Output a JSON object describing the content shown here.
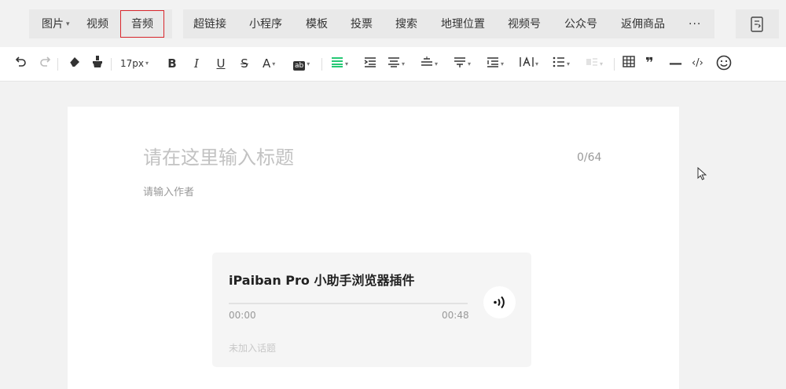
{
  "insert_bar": {
    "items": [
      {
        "label": "图片",
        "caret": "▾"
      },
      {
        "label": "视频"
      },
      {
        "label": "音频"
      },
      {
        "label": "超链接"
      },
      {
        "label": "小程序"
      },
      {
        "label": "模板"
      },
      {
        "label": "投票"
      },
      {
        "label": "搜索"
      },
      {
        "label": "地理位置"
      },
      {
        "label": "视频号"
      },
      {
        "label": "公众号"
      },
      {
        "label": "返佣商品"
      },
      {
        "label": "···"
      }
    ],
    "highlight_color": "#d9262c"
  },
  "toolbar": {
    "font_size": "17px",
    "bold": "B",
    "italic": "I",
    "underline": "U",
    "strike": "S",
    "font_color": "A",
    "bg_color": "ab",
    "quote": "❞",
    "code": "‹/›",
    "hr": "—",
    "accent_color": "#07c160"
  },
  "editor": {
    "title_placeholder": "请在这里输入标题",
    "title_counter": "0/64",
    "author_placeholder": "请输入作者"
  },
  "audio_card": {
    "title": "iPaiban Pro 小助手浏览器插件",
    "current_time": "00:00",
    "duration": "00:48",
    "topic_placeholder": "未加入话题"
  }
}
